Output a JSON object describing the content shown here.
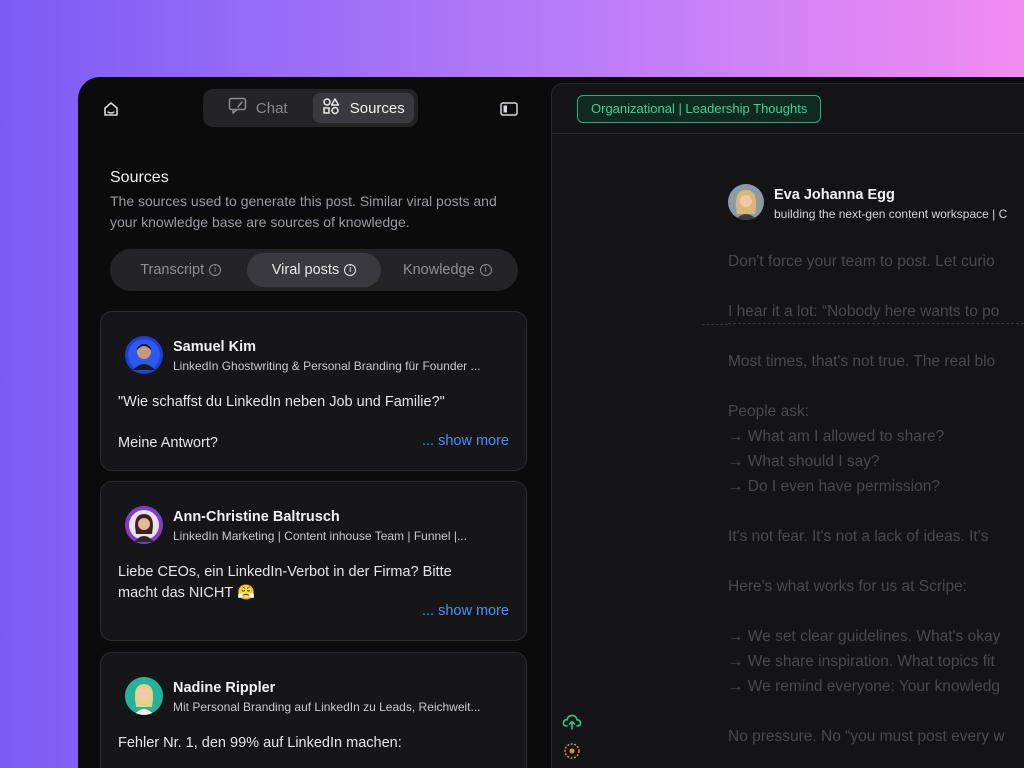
{
  "nav": {
    "chat_label": "Chat",
    "sources_label": "Sources"
  },
  "sources": {
    "title": "Sources",
    "description": "The sources used to generate this post. Similar viral posts and your knowledge base are sources of knowledge.",
    "tabs": [
      {
        "label": "Transcript",
        "active": false
      },
      {
        "label": "Viral posts",
        "active": true
      },
      {
        "label": "Knowledge",
        "active": false
      }
    ],
    "posts": [
      {
        "author": "Samuel Kim",
        "headline": "LinkedIn Ghostwriting & Personal Branding für Founder ...",
        "line1": "\"Wie schaffst du LinkedIn neben Job und Familie?\"",
        "line2": "Meine Antwort?",
        "show_more": "... show more"
      },
      {
        "author": "Ann-Christine Baltrusch",
        "headline": "LinkedIn Marketing | Content inhouse Team | Funnel |...",
        "line1": "Liebe CEOs, ein LinkedIn-Verbot in der Firma? Bitte",
        "line2": "macht das NICHT 😤",
        "show_more": "... show more"
      },
      {
        "author": "Nadine Rippler",
        "headline": "Mit Personal Branding auf LinkedIn zu Leads, Reichweit...",
        "line1": "Fehler Nr. 1, den 99% auf LinkedIn machen:"
      }
    ]
  },
  "editor": {
    "tag": "Organizational | Leadership Thoughts",
    "author": "Eva Johanna Egg",
    "headline": "building the next-gen content workspace | C",
    "lines": [
      "Don't force your team to post. Let curio",
      "",
      "I hear it a lot: “Nobody here wants to po",
      "",
      "Most times, that's not true. The real blo",
      "",
      "People ask:",
      "→ What am I allowed to share?",
      "→ What should I say?",
      "→ Do I even have permission?",
      "",
      "It's not fear. It's not a lack of ideas. It's",
      "",
      "Here's what works for us at Scripe:",
      "",
      "→ We set clear guidelines. What's okay",
      "→ We share inspiration. What topics fit",
      "→ We remind everyone: Your knowledg",
      "",
      "No pressure. No “you must post every w"
    ]
  },
  "colors": {
    "accent_blue": "#4e8ef7",
    "tag_green": "#37d399",
    "background": "#0b0b0c"
  }
}
